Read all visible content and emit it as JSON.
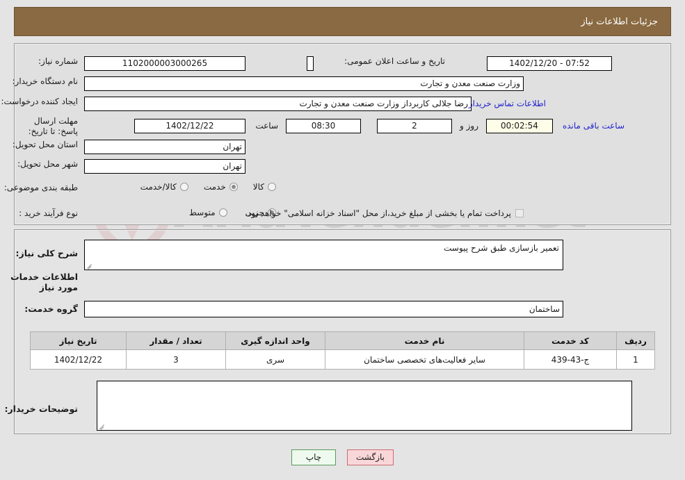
{
  "header": {
    "title": "جزئیات اطلاعات نیاز"
  },
  "form": {
    "need_number_label": "شماره نیاز:",
    "need_number_value": "1102000003000265",
    "announce_datetime_label": "تاریخ و ساعت اعلان عمومی:",
    "announce_datetime_value": "07:52 - 1402/12/20",
    "buyer_org_label": "نام دستگاه خریدار:",
    "buyer_org_value": "وزارت صنعت معدن و تجارت",
    "creator_label": "ایجاد کننده درخواست:",
    "creator_value": "رضا جلالی کاربرداز وزارت صنعت معدن و تجارت",
    "contact_link": "اطلاعات تماس خریدار",
    "deadline_label": "مهلت ارسال پاسخ: تا تاریخ:",
    "deadline_date": "1402/12/22",
    "hour_label": "ساعت",
    "deadline_time": "08:30",
    "days_value": "2",
    "days_label": "روز و",
    "countdown_value": "00:02:54",
    "countdown_label": "ساعت باقی مانده",
    "province_label": "استان محل تحویل:",
    "province_value": "تهران",
    "city_label": "شهر محل تحویل:",
    "city_value": "تهران",
    "category_label": "طبقه بندی موضوعی:",
    "category_options": [
      {
        "label": "کالا",
        "checked": false
      },
      {
        "label": "خدمت",
        "checked": true
      },
      {
        "label": "کالا/خدمت",
        "checked": false
      }
    ],
    "process_label": "نوع فرآیند خرید :",
    "process_options": [
      {
        "label": "جزیی",
        "checked": true
      },
      {
        "label": "متوسط",
        "checked": false
      }
    ],
    "treasury_checkbox_label": "پرداخت تمام یا بخشی از مبلغ خرید،از محل \"اسناد خزانه اسلامی\" خواهد بود.",
    "treasury_checked": false
  },
  "description": {
    "general_need_label": "شرح کلی نیاز:",
    "general_need_value": "تعمیر بازسازی طبق شرح پیوست",
    "services_section_title": "اطلاعات خدمات مورد نیاز",
    "service_group_label": "گروه خدمت:",
    "service_group_value": "ساختمان"
  },
  "table": {
    "columns": [
      "ردیف",
      "کد خدمت",
      "نام خدمت",
      "واحد اندازه گیری",
      "تعداد / مقدار",
      "تاریخ نیاز"
    ],
    "rows": [
      {
        "index": "1",
        "code": "ج-43-439",
        "name": "سایر فعالیت‌های تخصصی ساختمان",
        "unit": "سری",
        "quantity": "3",
        "need_date": "1402/12/22"
      }
    ]
  },
  "buyer_notes": {
    "label": "توضیحات خریدار:",
    "value": ""
  },
  "actions": {
    "back_label": "بازگشت",
    "print_label": "چاپ"
  },
  "watermark": {
    "text": "AriaTender.net"
  },
  "colors": {
    "header_bg": "#8a6a42",
    "link": "#2222cc",
    "back_btn_bg": "#f9d7d9",
    "print_btn_bg": "#eefaee",
    "countdown_bg": "#fdfde8"
  }
}
